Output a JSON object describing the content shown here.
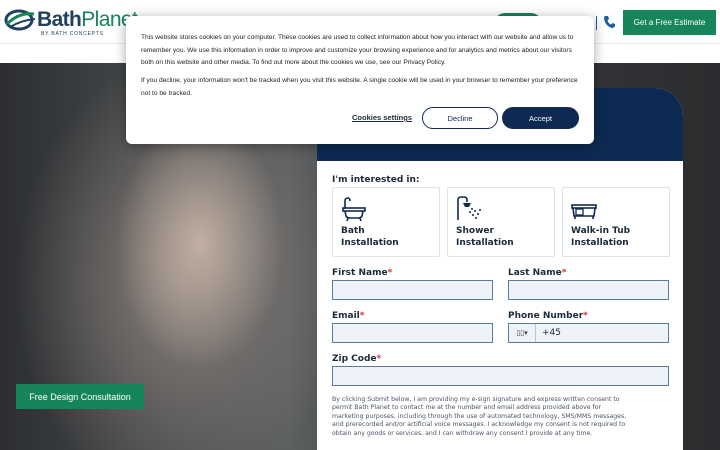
{
  "header": {
    "logo_main": "Bath",
    "logo_accent": "Planet",
    "logo_sub": "BY BATH CONCEPTS",
    "phone_icon": "phone-icon",
    "estimate_label": "Get a Free Estimate"
  },
  "hero": {
    "consult_label": "Free Design Consultation"
  },
  "form": {
    "interest_label": "I'm interested in:",
    "options": [
      {
        "line1": "Bath",
        "line2": "Installation",
        "icon": "bathtub-icon"
      },
      {
        "line1": "Shower",
        "line2": "Installation",
        "icon": "shower-icon"
      },
      {
        "line1": "Walk-in Tub",
        "line2": "Installation",
        "icon": "walkin-tub-icon"
      }
    ],
    "first_name_label": "First Name",
    "last_name_label": "Last Name",
    "email_label": "Email",
    "phone_label": "Phone Number",
    "zip_label": "Zip Code",
    "required_mark": "*",
    "phone_value": "+45",
    "flag_glyph": "▯▯▾",
    "consent": "By clicking Submit below, I am providing my e-sign signature and express written consent to permit Bath Planet to contact me at the number and email address provided above for marketing purposes, including through the use of automated technology, SMS/MMS messages, and prerecorded and/or artificial voice messages. I acknowledge my consent is not required to obtain any goods or services, and I can withdraw any consent I provide at any time."
  },
  "cookie": {
    "para1": "This website stores cookies on your computer. These cookies are used to collect information about how you interact with our website and allow us to remember you. We use this information in order to improve and customize your browsing experience and for analytics and metrics about our visitors both on this website and other media. To find out more about the cookies we use, see our Privacy Policy.",
    "para2": "If you decline, your information won't be tracked when you visit this website. A single cookie will be used in your browser to remember your preference not to be tracked.",
    "settings_label": "Cookies settings",
    "decline_label": "Decline",
    "accept_label": "Accept"
  },
  "colors": {
    "brand_green": "#17855a",
    "brand_navy": "#0e2a52",
    "required_red": "#d0322e"
  }
}
